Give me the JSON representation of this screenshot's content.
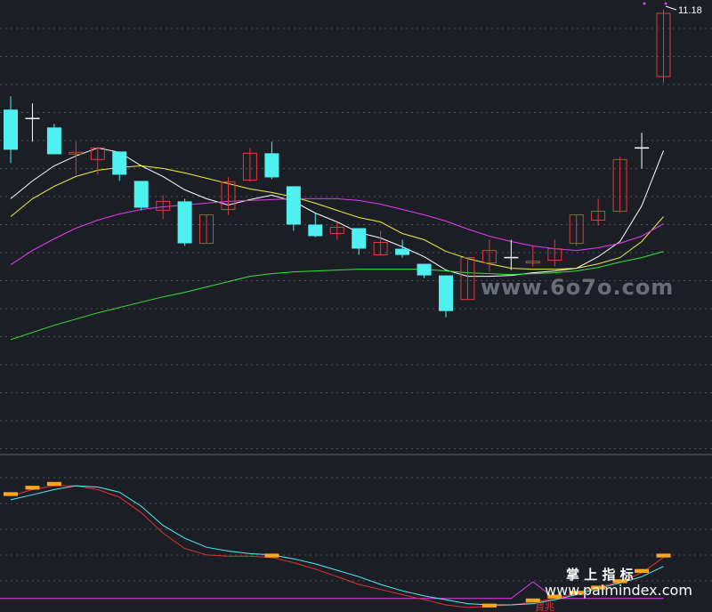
{
  "chart_data": [
    {
      "type": "candlestick",
      "panel": "main",
      "ylim": [
        6.3,
        11.3
      ],
      "price_label": "11.18",
      "colors": {
        "up": "#e03a3a",
        "down": "#4ff0f0",
        "doji": "#ffffff",
        "background": "#1c1e26",
        "grid": "#4a4e58"
      },
      "candles": [
        {
          "o": 10.1,
          "h": 10.25,
          "l": 9.5,
          "c": 9.65,
          "t": "down"
        },
        {
          "o": 10.0,
          "h": 10.17,
          "l": 9.74,
          "c": 10.0,
          "t": "doji"
        },
        {
          "o": 9.9,
          "h": 9.94,
          "l": 9.6,
          "c": 9.6,
          "t": "down"
        },
        {
          "o": 9.6,
          "h": 9.74,
          "l": 9.37,
          "c": 9.62,
          "t": "up"
        },
        {
          "o": 9.54,
          "h": 9.67,
          "l": 9.37,
          "c": 9.67,
          "t": "up"
        },
        {
          "o": 9.63,
          "h": 9.63,
          "l": 9.3,
          "c": 9.37,
          "t": "down"
        },
        {
          "o": 9.3,
          "h": 9.3,
          "l": 8.97,
          "c": 9.0,
          "t": "down"
        },
        {
          "o": 8.97,
          "h": 9.14,
          "l": 8.87,
          "c": 9.07,
          "t": "up"
        },
        {
          "o": 9.07,
          "h": 9.1,
          "l": 8.57,
          "c": 8.6,
          "t": "down"
        },
        {
          "o": 8.6,
          "h": 8.92,
          "l": 8.6,
          "c": 8.92,
          "t": "up"
        },
        {
          "o": 8.98,
          "h": 9.34,
          "l": 8.92,
          "c": 9.29,
          "t": "up"
        },
        {
          "o": 9.31,
          "h": 9.67,
          "l": 9.29,
          "c": 9.61,
          "t": "up"
        },
        {
          "o": 9.61,
          "h": 9.74,
          "l": 9.32,
          "c": 9.34,
          "t": "down"
        },
        {
          "o": 9.24,
          "h": 9.24,
          "l": 8.74,
          "c": 8.81,
          "t": "down"
        },
        {
          "o": 8.81,
          "h": 8.94,
          "l": 8.67,
          "c": 8.68,
          "t": "down"
        },
        {
          "o": 8.71,
          "h": 8.84,
          "l": 8.64,
          "c": 8.78,
          "t": "up"
        },
        {
          "o": 8.77,
          "h": 8.77,
          "l": 8.47,
          "c": 8.54,
          "t": "down"
        },
        {
          "o": 8.47,
          "h": 8.74,
          "l": 8.47,
          "c": 8.61,
          "t": "up"
        },
        {
          "o": 8.54,
          "h": 8.64,
          "l": 8.44,
          "c": 8.47,
          "t": "down"
        },
        {
          "o": 8.37,
          "h": 8.37,
          "l": 8.21,
          "c": 8.24,
          "t": "down"
        },
        {
          "o": 8.24,
          "h": 8.24,
          "l": 7.77,
          "c": 7.84,
          "t": "down"
        },
        {
          "o": 7.97,
          "h": 8.44,
          "l": 7.97,
          "c": 8.44,
          "t": "up"
        },
        {
          "o": 8.38,
          "h": 8.64,
          "l": 8.28,
          "c": 8.52,
          "t": "up"
        },
        {
          "o": 8.44,
          "h": 8.64,
          "l": 8.3,
          "c": 8.44,
          "t": "doji"
        },
        {
          "o": 8.38,
          "h": 8.57,
          "l": 8.34,
          "c": 8.4,
          "t": "up"
        },
        {
          "o": 8.41,
          "h": 8.64,
          "l": 8.34,
          "c": 8.54,
          "t": "up"
        },
        {
          "o": 8.6,
          "h": 8.92,
          "l": 8.57,
          "c": 8.92,
          "t": "up"
        },
        {
          "o": 8.86,
          "h": 9.1,
          "l": 8.8,
          "c": 8.96,
          "t": "up"
        },
        {
          "o": 8.96,
          "h": 9.57,
          "l": 8.94,
          "c": 9.54,
          "t": "up"
        },
        {
          "o": 9.67,
          "h": 9.84,
          "l": 9.44,
          "c": 9.67,
          "t": "doji"
        },
        {
          "o": 10.47,
          "h": 11.22,
          "l": 10.4,
          "c": 11.18,
          "t": "up"
        }
      ],
      "moving_averages": [
        {
          "color": "#ffffff",
          "values": [
            9.1,
            9.3,
            9.47,
            9.58,
            9.67,
            9.62,
            9.47,
            9.35,
            9.2,
            9.1,
            9.03,
            9.09,
            9.14,
            9.07,
            8.94,
            8.84,
            8.72,
            8.66,
            8.56,
            8.45,
            8.3,
            8.23,
            8.23,
            8.24,
            8.27,
            8.29,
            8.32,
            8.45,
            8.62,
            9.02,
            9.64
          ]
        },
        {
          "color": "#f0f03c",
          "values": [
            8.9,
            9.1,
            9.24,
            9.35,
            9.42,
            9.45,
            9.47,
            9.44,
            9.39,
            9.33,
            9.27,
            9.21,
            9.17,
            9.12,
            9.05,
            8.97,
            8.89,
            8.84,
            8.71,
            8.64,
            8.51,
            8.43,
            8.37,
            8.32,
            8.31,
            8.31,
            8.32,
            8.37,
            8.44,
            8.62,
            8.9
          ]
        },
        {
          "color": "#e53cf0",
          "values": [
            8.36,
            8.52,
            8.65,
            8.77,
            8.86,
            8.93,
            8.98,
            9.01,
            9.03,
            9.05,
            9.07,
            9.08,
            9.09,
            9.1,
            9.1,
            9.1,
            9.08,
            9.04,
            8.98,
            8.92,
            8.85,
            8.76,
            8.68,
            8.62,
            8.57,
            8.54,
            8.52,
            8.55,
            8.6,
            8.68,
            8.82
          ]
        },
        {
          "color": "#32e632",
          "values": [
            7.52,
            7.6,
            7.68,
            7.75,
            7.82,
            7.88,
            7.94,
            8.0,
            8.05,
            8.11,
            8.17,
            8.23,
            8.26,
            8.28,
            8.29,
            8.3,
            8.31,
            8.31,
            8.31,
            8.31,
            8.29,
            8.27,
            8.26,
            8.25,
            8.26,
            8.27,
            8.29,
            8.33,
            8.39,
            8.44,
            8.51
          ]
        }
      ],
      "watermark": "www.6o7o.com"
    },
    {
      "type": "indicator",
      "panel": "sub",
      "ylim": [
        0,
        1
      ],
      "colors": {
        "bar": "#ffa51e",
        "fast": "#4ff0f0",
        "slow": "#e03232",
        "baseline": "#e53cf0"
      },
      "bars": [
        {
          "i": 0,
          "v": 0.88
        },
        {
          "i": 1,
          "v": 0.93
        },
        {
          "i": 2,
          "v": 0.96
        },
        {
          "i": 12,
          "v": 0.4
        },
        {
          "i": 22,
          "v": 0.01
        },
        {
          "i": 24,
          "v": 0.05
        },
        {
          "i": 25,
          "v": 0.08
        },
        {
          "i": 26,
          "v": 0.11
        },
        {
          "i": 27,
          "v": 0.15
        },
        {
          "i": 28,
          "v": 0.2
        },
        {
          "i": 29,
          "v": 0.28
        },
        {
          "i": 30,
          "v": 0.4
        }
      ],
      "fast_line": [
        0.82,
        0.86,
        0.9,
        0.93,
        0.92,
        0.88,
        0.77,
        0.62,
        0.52,
        0.45,
        0.42,
        0.4,
        0.39,
        0.36,
        0.32,
        0.27,
        0.22,
        0.16,
        0.11,
        0.07,
        0.04,
        0.01,
        0.0,
        0.0,
        0.01,
        0.04,
        0.08,
        0.13,
        0.17,
        0.22,
        0.3
      ],
      "slow_line": [
        0.85,
        0.9,
        0.93,
        0.93,
        0.9,
        0.84,
        0.72,
        0.56,
        0.44,
        0.39,
        0.38,
        0.38,
        0.37,
        0.33,
        0.28,
        0.22,
        0.16,
        0.12,
        0.08,
        0.04,
        0.0,
        -0.02,
        -0.01,
        0.0,
        0.02,
        0.05,
        0.09,
        0.14,
        0.18,
        0.25,
        0.37
      ],
      "baseline_value": 0.05,
      "signal_index": 24,
      "signal_label": "買兆",
      "watermark_cn": "掌 上 指 标",
      "watermark": "www.palmindex.com"
    }
  ]
}
